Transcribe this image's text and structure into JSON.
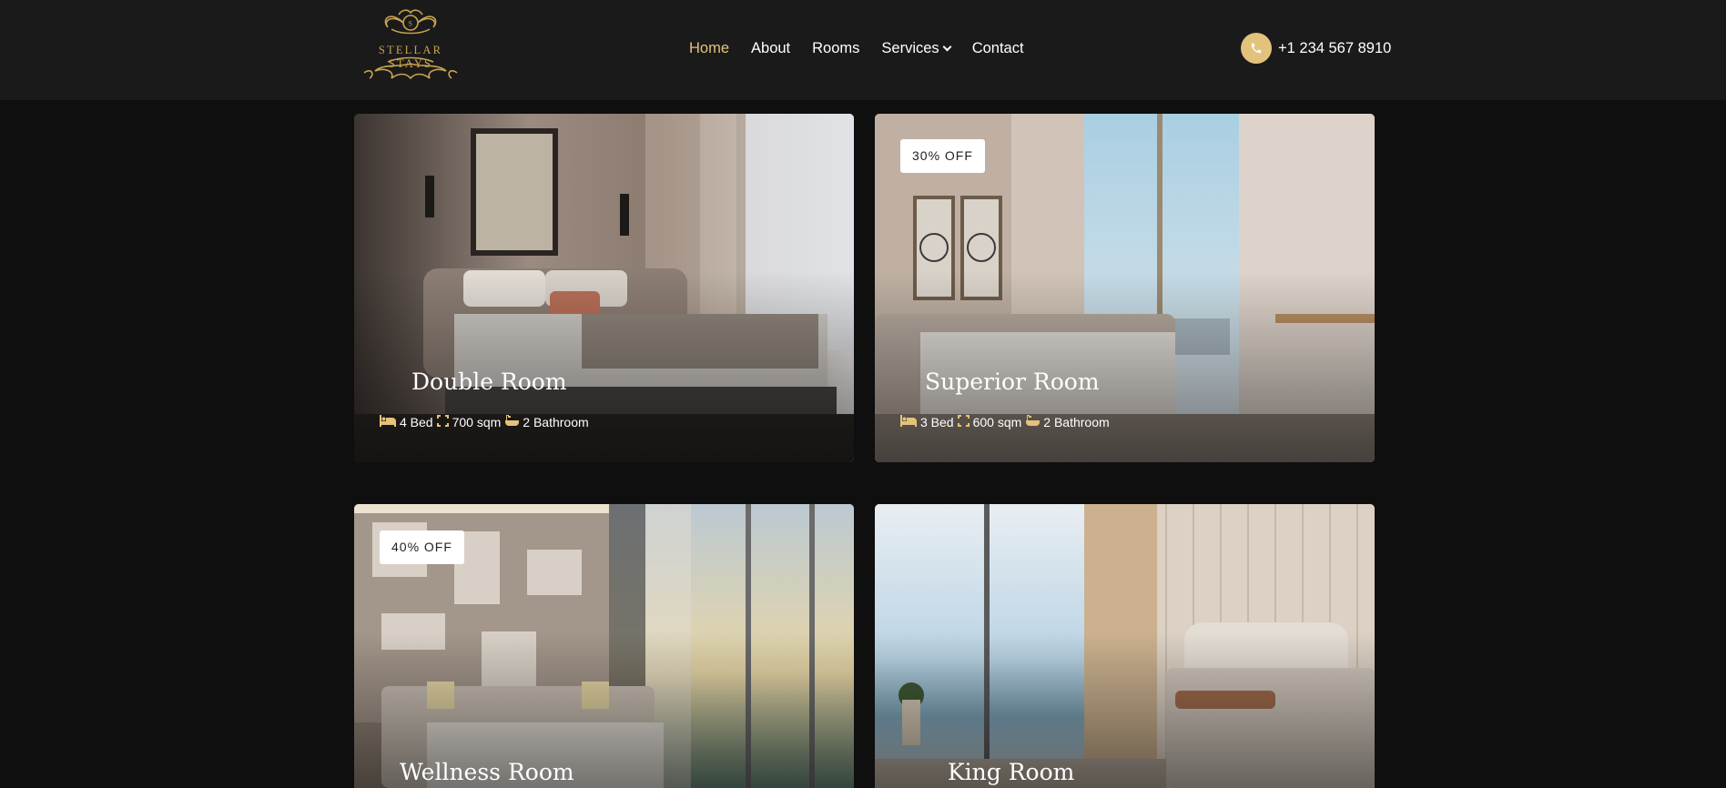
{
  "brand": {
    "name": "STELLAR STAYS"
  },
  "nav": {
    "items": [
      {
        "label": "Home",
        "active": true
      },
      {
        "label": "About"
      },
      {
        "label": "Rooms"
      },
      {
        "label": "Services",
        "has_dropdown": true
      },
      {
        "label": "Contact"
      }
    ]
  },
  "contact": {
    "phone": "+1 234 567 8910",
    "icon": "phone-icon"
  },
  "colors": {
    "accent": "#e5c27a",
    "header_bg": "#1a1a1a",
    "page_bg": "#0f0f0f"
  },
  "rooms": [
    {
      "title": "Double Room",
      "badge": "",
      "beds": "4 Bed",
      "size": "700 sqm",
      "baths": "2 Bathroom"
    },
    {
      "title": "Superior Room",
      "badge": "30% OFF",
      "beds": "3 Bed",
      "size": "600 sqm",
      "baths": "2 Bathroom"
    },
    {
      "title": "Wellness Room",
      "badge": "40% OFF"
    },
    {
      "title": "King Room",
      "badge": ""
    }
  ]
}
